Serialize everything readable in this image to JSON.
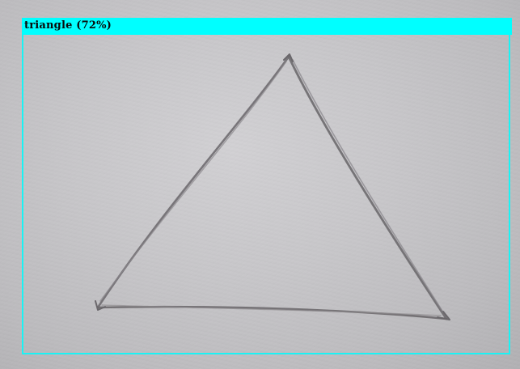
{
  "detection": {
    "label": "triangle (72%)",
    "box_color": "#00ffff"
  },
  "sketch": {
    "shape": "triangle",
    "stroke_color": "#6d6a6e"
  }
}
